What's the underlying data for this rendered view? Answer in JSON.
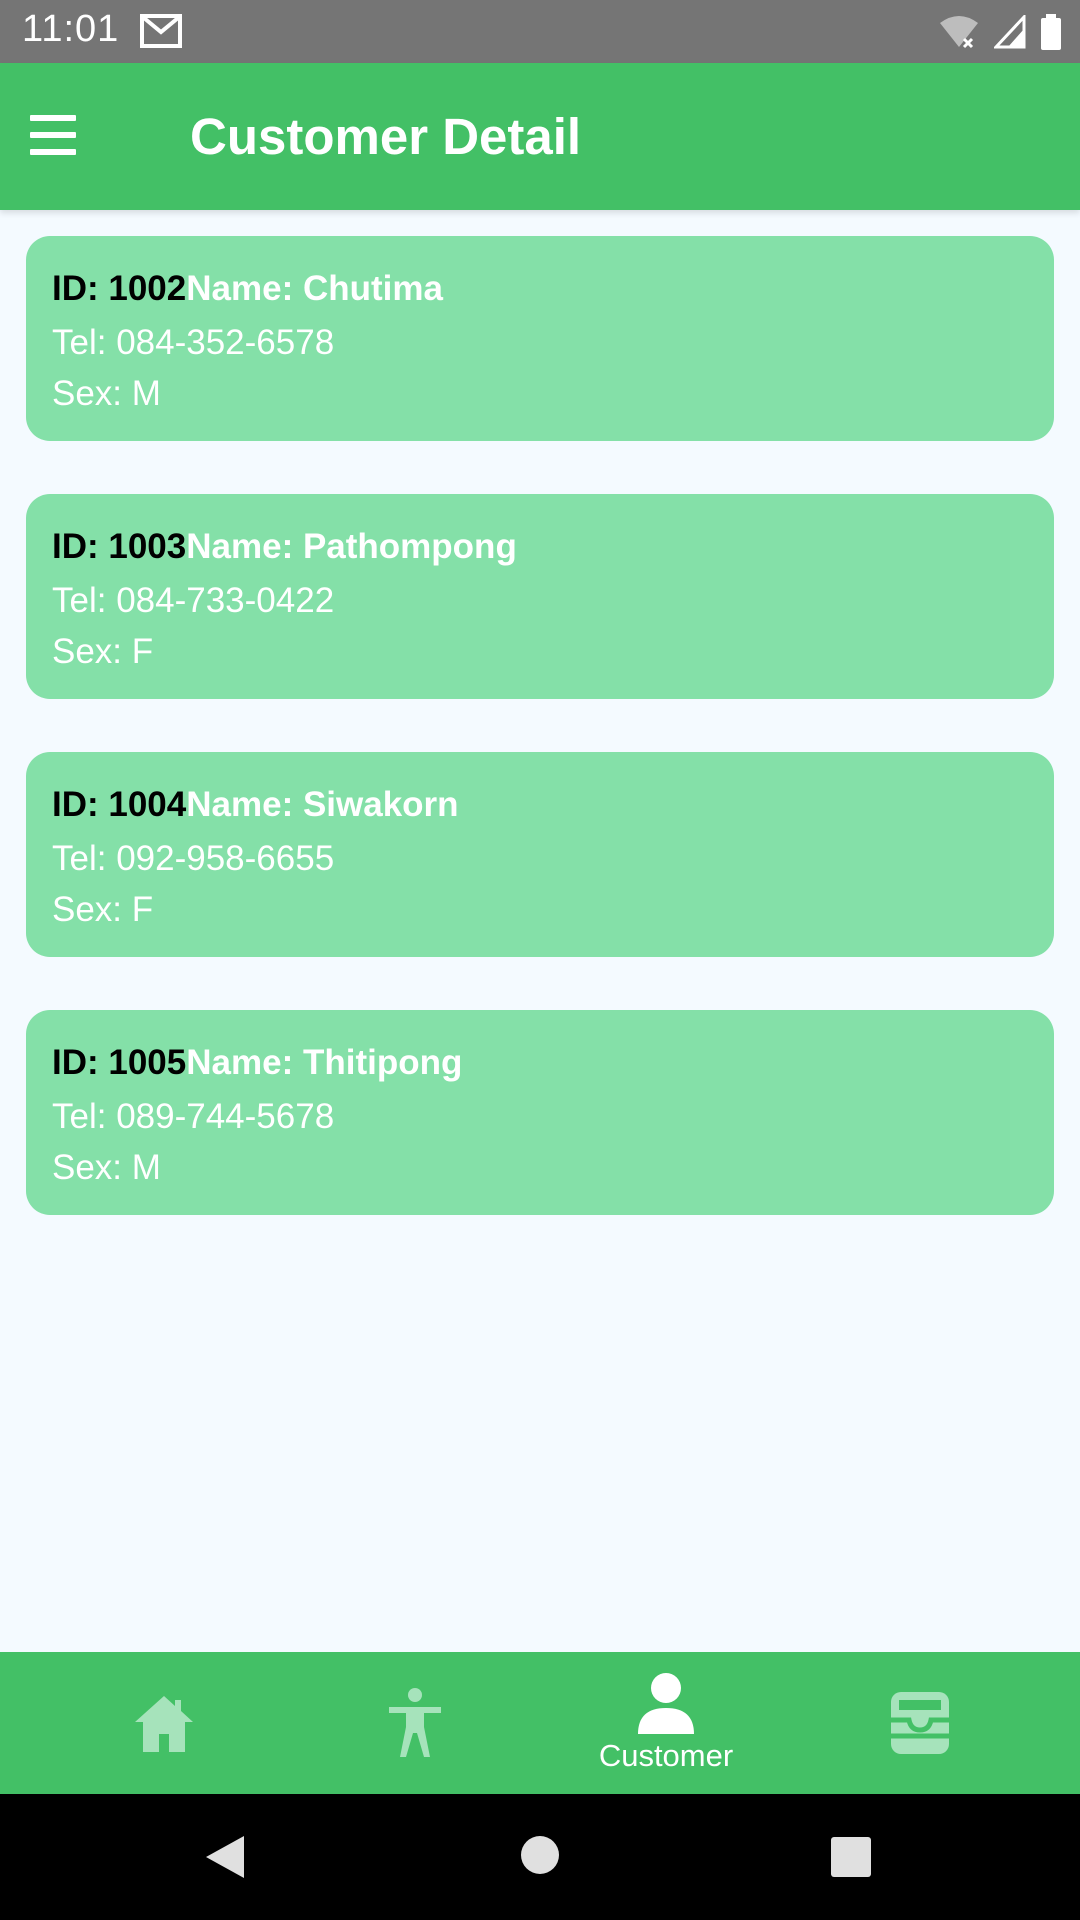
{
  "status_bar": {
    "time": "11:01"
  },
  "app_bar": {
    "title": "Customer Detail"
  },
  "customers": [
    {
      "id": "ID: 1002",
      "name": "Name: Chutima",
      "tel": "Tel: 084-352-6578",
      "sex": "Sex: M"
    },
    {
      "id": "ID: 1003",
      "name": "Name: Pathompong",
      "tel": "Tel: 084-733-0422",
      "sex": "Sex: F"
    },
    {
      "id": "ID: 1004",
      "name": "Name: Siwakorn",
      "tel": "Tel: 092-958-6655",
      "sex": "Sex: F"
    },
    {
      "id": "ID: 1005",
      "name": "Name: Thitipong",
      "tel": "Tel: 089-744-5678",
      "sex": "Sex: M"
    }
  ],
  "bottom_nav": {
    "items": [
      {
        "icon": "home-icon",
        "label": ""
      },
      {
        "icon": "accessibility-icon",
        "label": ""
      },
      {
        "icon": "person-icon",
        "label": "Customer",
        "active": true
      },
      {
        "icon": "inbox-icon",
        "label": ""
      }
    ]
  },
  "colors": {
    "primary": "#43c066",
    "card": "#84e0a8",
    "background": "#f4faff",
    "inactive_icon": "#a6e3bb"
  }
}
